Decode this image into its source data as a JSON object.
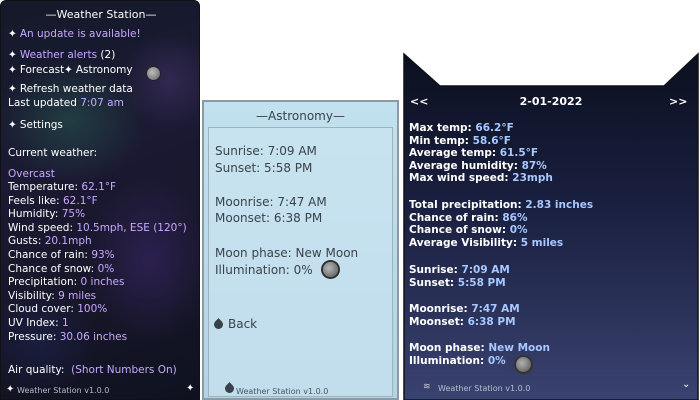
{
  "left": {
    "title": "—Weather Station—",
    "update_text": "An update is available!",
    "alerts_label": "Weather alerts",
    "alerts_count": "(2)",
    "forecast_label": "Forecast",
    "astronomy_label": "Astronomy",
    "refresh_label": "Refresh weather data",
    "last_updated_label": "Last updated",
    "last_updated_value": "7:07 am",
    "settings_label": "Settings",
    "current_weather_label": "Current weather:",
    "condition": "Overcast",
    "metrics": [
      {
        "label": "Temperature:",
        "value": "62.1°F"
      },
      {
        "label": "Feels like:",
        "value": "62.1°F"
      },
      {
        "label": "Humidity:",
        "value": "75%"
      },
      {
        "label": "Wind speed:",
        "value": "10.5mph, ESE (120°)"
      },
      {
        "label": "Gusts:",
        "value": "20.1mph"
      },
      {
        "label": "Chance of rain:",
        "value": "93%"
      },
      {
        "label": "Chance of snow:",
        "value": "0%"
      },
      {
        "label": "Precipitation:",
        "value": "0 inches"
      },
      {
        "label": "Visibility:",
        "value": "9 miles"
      },
      {
        "label": "Cloud cover:",
        "value": "100%"
      },
      {
        "label": "UV Index:",
        "value": "1"
      },
      {
        "label": "Pressure:",
        "value": "30.06 inches"
      }
    ],
    "air_quality_label": "Air quality:",
    "air_quality_value": "(Short Numbers On)",
    "footer": "Weather Station v1.0.0"
  },
  "middle": {
    "title": "—Astronomy—",
    "sunrise": "Sunrise: 7:09 AM",
    "sunset": "Sunset: 5:58 PM",
    "moonrise": "Moonrise: 7:47 AM",
    "moonset": "Moonset: 6:38 PM",
    "moon_phase": "Moon phase: New Moon",
    "illumination": "Illumination: 0%",
    "back_label": "Back",
    "footer": "Weather Station v1.0.0"
  },
  "right": {
    "prev": "<<",
    "date": "2-01-2022",
    "next": ">>",
    "stats": [
      {
        "label": "Max temp:",
        "value": "66.2°F"
      },
      {
        "label": "Min temp:",
        "value": "58.6°F"
      },
      {
        "label": "Average temp:",
        "value": "61.5°F"
      },
      {
        "label": "Average humidity:",
        "value": "87%"
      },
      {
        "label": "Max wind speed:",
        "value": "23mph"
      }
    ],
    "stats2": [
      {
        "label": "Total precipitation:",
        "value": "2.83 inches"
      },
      {
        "label": "Chance of rain:",
        "value": "86%"
      },
      {
        "label": "Chance of snow:",
        "value": "0%"
      },
      {
        "label": "Average Visibility:",
        "value": "5 miles"
      }
    ],
    "sun": [
      {
        "label": "Sunrise:",
        "value": "7:09 AM"
      },
      {
        "label": "Sunset:",
        "value": "5:58 PM"
      }
    ],
    "moon": [
      {
        "label": "Moonrise:",
        "value": "7:47 AM"
      },
      {
        "label": "Moonset:",
        "value": "6:38 PM"
      }
    ],
    "phase": [
      {
        "label": "Moon phase:",
        "value": "New Moon"
      },
      {
        "label": "Illumination:",
        "value": "0%"
      }
    ],
    "footer": "Weather Station v1.0.0"
  },
  "colors": {
    "accent_purple": "#c9a8ff",
    "right_value_blue": "#a8c8ff",
    "mid_panel_bg": "#c2e1ee"
  },
  "icons": [
    "sparkle-icon",
    "moon-icon",
    "drop-icon",
    "wind-icon",
    "chevron-down-icon"
  ]
}
